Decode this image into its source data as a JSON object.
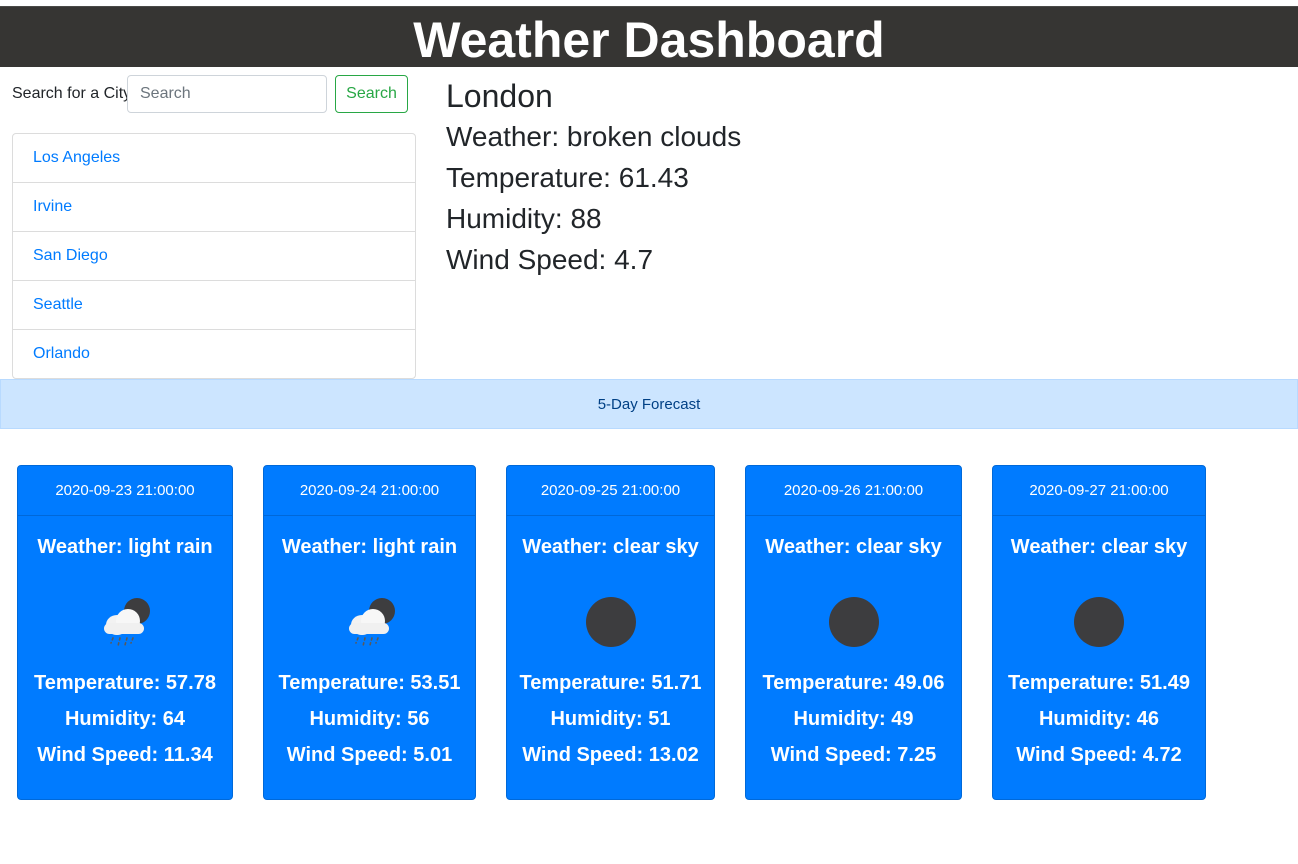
{
  "header": {
    "title": "Weather Dashboard"
  },
  "search": {
    "label": "Search for a City",
    "placeholder": "Search",
    "value": "",
    "button_label": "Search"
  },
  "cities": [
    "Los Angeles",
    "Irvine",
    "San Diego",
    "Seattle",
    "Orlando"
  ],
  "current": {
    "city": "London",
    "weather": "Weather: broken clouds",
    "temperature": "Temperature: 61.43",
    "humidity": "Humidity: 88",
    "wind": "Wind Speed: 4.7"
  },
  "forecast_title": "5-Day Forecast",
  "forecast": [
    {
      "date": "2020-09-23 21:00:00",
      "weather": "Weather: light rain",
      "icon": "rain-cloud-icon",
      "temperature": "Temperature: 57.78",
      "humidity": "Humidity: 64",
      "wind": "Wind Speed: 11.34"
    },
    {
      "date": "2020-09-24 21:00:00",
      "weather": "Weather: light rain",
      "icon": "rain-cloud-icon",
      "temperature": "Temperature: 53.51",
      "humidity": "Humidity: 56",
      "wind": "Wind Speed: 5.01"
    },
    {
      "date": "2020-09-25 21:00:00",
      "weather": "Weather: clear sky",
      "icon": "clear-sky-icon",
      "temperature": "Temperature: 51.71",
      "humidity": "Humidity: 51",
      "wind": "Wind Speed: 13.02"
    },
    {
      "date": "2020-09-26 21:00:00",
      "weather": "Weather: clear sky",
      "icon": "clear-sky-icon",
      "temperature": "Temperature: 49.06",
      "humidity": "Humidity: 49",
      "wind": "Wind Speed: 7.25"
    },
    {
      "date": "2020-09-27 21:00:00",
      "weather": "Weather: clear sky",
      "icon": "clear-sky-icon",
      "temperature": "Temperature: 51.49",
      "humidity": "Humidity: 46",
      "wind": "Wind Speed: 4.72"
    }
  ],
  "colors": {
    "header_bg": "#363533",
    "card_bg": "#007bff",
    "link": "#007bff",
    "search_button": "#28a745",
    "forecast_bar_bg": "#cce5ff"
  }
}
